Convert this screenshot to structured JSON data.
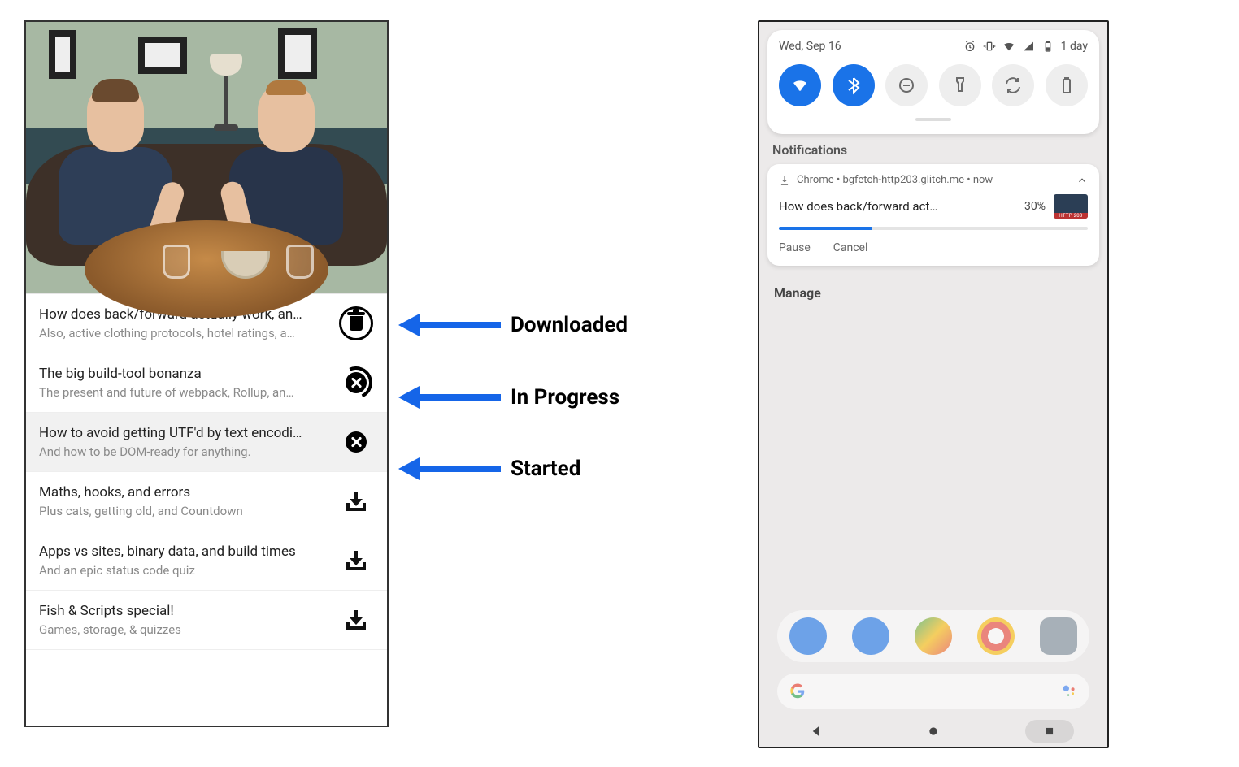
{
  "labels": {
    "downloaded": "Downloaded",
    "in_progress": "In Progress",
    "started": "Started"
  },
  "app": {
    "episodes": [
      {
        "title": "How does back/forward actually work, an…",
        "subtitle": "Also, active clothing protocols, hotel ratings, a…",
        "state": "downloaded"
      },
      {
        "title": "The big build-tool bonanza",
        "subtitle": "The present and future of webpack, Rollup, an…",
        "state": "in_progress"
      },
      {
        "title": "How to avoid getting UTF'd by text encodi…",
        "subtitle": "And how to be DOM-ready for anything.",
        "state": "started"
      },
      {
        "title": "Maths, hooks, and errors",
        "subtitle": "Plus cats, getting old, and Countdown",
        "state": "none"
      },
      {
        "title": "Apps vs sites, binary data, and build times",
        "subtitle": "And an epic status code quiz",
        "state": "none"
      },
      {
        "title": "Fish & Scripts special!",
        "subtitle": "Games, storage, & quizzes",
        "state": "none"
      }
    ]
  },
  "phone": {
    "date": "Wed, Sep 16",
    "battery_text": "1 day",
    "section_notifications": "Notifications",
    "notification": {
      "source": "Chrome  •  bgfetch-http203.glitch.me  •  now",
      "title": "How does back/forward act…",
      "percent_text": "30%",
      "percent": 30,
      "action_pause": "Pause",
      "action_cancel": "Cancel"
    },
    "manage": "Manage"
  }
}
